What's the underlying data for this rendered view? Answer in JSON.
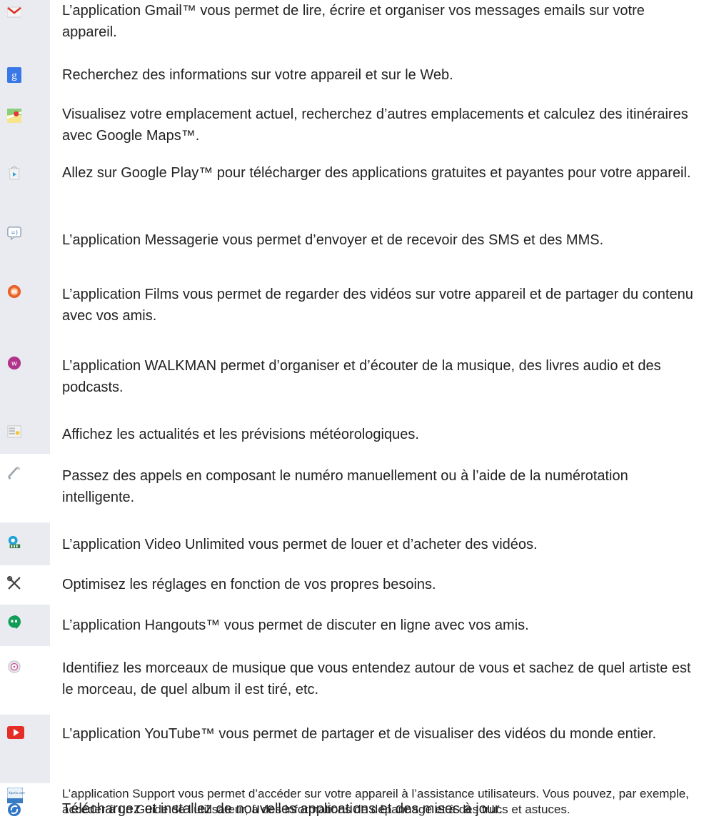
{
  "items": [
    {
      "icon": "gmail-icon",
      "text": "L’application Gmail™ vous permet de lire, écrire et organiser vos messages emails sur votre appareil."
    },
    {
      "icon": "google-search-icon",
      "text": "Recherchez des informations sur votre appareil et sur le Web."
    },
    {
      "icon": "maps-icon",
      "text": "Visualisez votre emplacement actuel, recherchez d’autres emplacements et calculez des itinéraires avec Google Maps™."
    },
    {
      "icon": "play-store-icon",
      "text": "Allez sur Google Play™ pour télécharger des applications gratuites et payantes pour votre appareil."
    },
    {
      "icon": "messaging-icon",
      "text": "L’application Messagerie vous permet d’envoyer et de recevoir des SMS et des MMS."
    },
    {
      "icon": "movies-icon",
      "text": "L’application Films vous permet de regarder des vidéos sur votre appareil et de partager du contenu avec vos amis."
    },
    {
      "icon": "walkman-icon",
      "text": "L’application WALKMAN permet d’organiser et d’écouter de la musique, des livres audio et des podcasts."
    },
    {
      "icon": "news-weather-icon",
      "text": "Affichez les actualités et les prévisions météorologiques."
    },
    {
      "icon": "phone-icon",
      "text": "Passez des appels en composant le numéro manuellement ou à l’aide de la numérotation intelligente."
    },
    {
      "icon": "video-unlimited-icon",
      "text": "L’application Video Unlimited vous permet de louer et d’acheter des vidéos."
    },
    {
      "icon": "settings-tools-icon",
      "text": "Optimisez les réglages en fonction de vos propres besoins."
    },
    {
      "icon": "hangouts-icon",
      "text": "L’application Hangouts™ vous permet de discuter en ligne avec vos amis."
    },
    {
      "icon": "trackid-icon",
      "text": "Identifiez les morceaux de musique que vous entendez autour de vous et sachez de quel artiste est le morceau, de quel album il est tiré, etc."
    },
    {
      "icon": "youtube-icon",
      "text": "L’application YouTube™ vous permet de partager et de visualiser des vidéos du monde entier."
    },
    {
      "icon": "xperia-care-icon",
      "icon_label": "Xperia care",
      "text": "L’application Support vous permet d’accéder sur votre appareil à l’assistance utilisateurs. Vous pouvez, par exemple, accéder à un Guide de l’utilisateur, à des informations de dépannage et à des trucs et astuces."
    },
    {
      "icon": "update-center-icon",
      "text": "Téléchargez et installez de nouvelles applications et des mises à jour."
    }
  ]
}
